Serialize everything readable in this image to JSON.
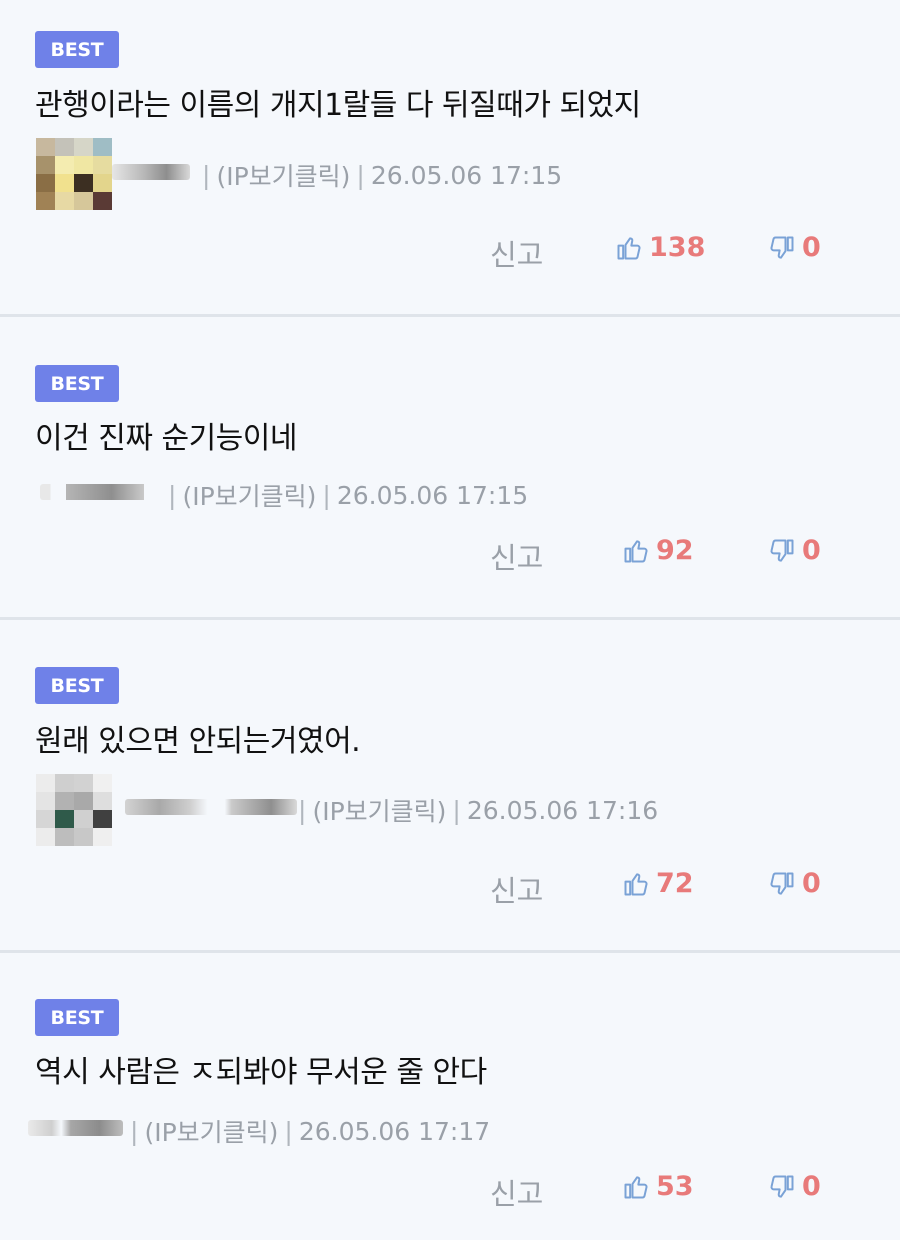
{
  "comments": [
    {
      "badge": "BEST",
      "text": "관행이라는 이름의 개지1랄들 다 뒤질때가 되었지",
      "ip": "(IP보기클릭)",
      "time": "26.05.06 17:15",
      "report": "신고",
      "likes": "138",
      "dislikes": "0"
    },
    {
      "badge": "BEST",
      "text": "이건 진짜 순기능이네",
      "ip": "(IP보기클릭)",
      "time": "26.05.06 17:15",
      "report": "신고",
      "likes": "92",
      "dislikes": "0"
    },
    {
      "badge": "BEST",
      "text": "원래 있으면 안되는거였어.",
      "ip": "(IP보기클릭)",
      "time": "26.05.06 17:16",
      "report": "신고",
      "likes": "72",
      "dislikes": "0"
    },
    {
      "badge": "BEST",
      "text": "역시 사람은 ㅈ되봐야 무서운 줄 안다",
      "ip": "(IP보기클릭)",
      "time": "26.05.06 17:17",
      "report": "신고",
      "likes": "53",
      "dislikes": "0"
    }
  ],
  "colors": {
    "badge": "#6f81e8",
    "like_count": "#e87a7a",
    "icon": "#7aa2d6",
    "meta": "#9aa0a8",
    "background": "#f5f8fc"
  }
}
